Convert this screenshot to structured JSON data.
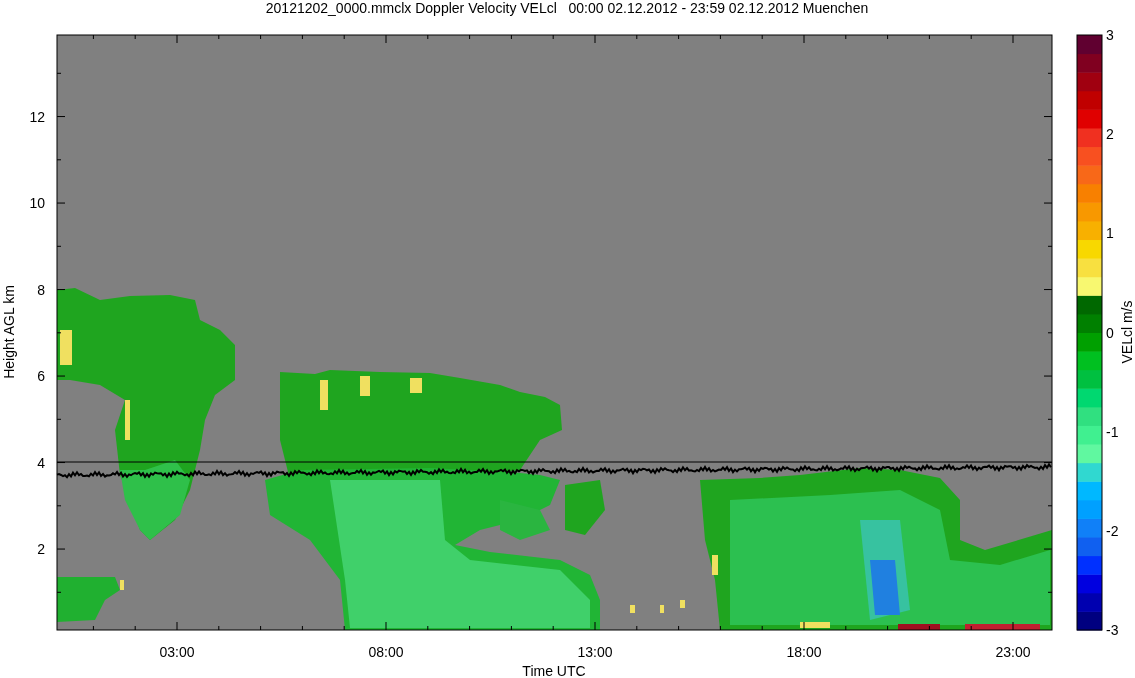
{
  "title": "20121202_0000.mmclx Doppler Velocity VELcl   00:00 02.12.2012 - 23:59 02.12.2012 Muenchen",
  "plot": {
    "ylabel": "Height AGL km",
    "xlabel": "Time UTC",
    "yticks": [
      "12",
      "10",
      "8",
      "6",
      "4",
      "2"
    ],
    "xticks": [
      "03:00",
      "08:00",
      "13:00",
      "18:00",
      "23:00"
    ]
  },
  "colorbar": {
    "label": "VELcl m/s",
    "ticks": [
      "3",
      "2",
      "1",
      "0",
      "-1",
      "-2",
      "-3"
    ]
  }
}
